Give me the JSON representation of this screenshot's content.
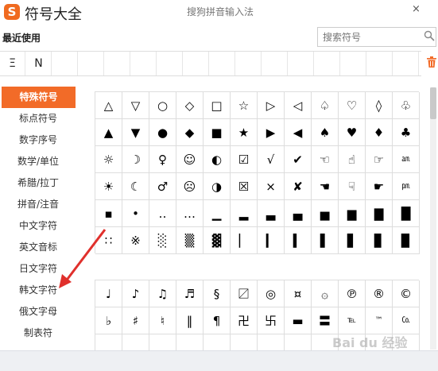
{
  "title_bar": {
    "logo_glyph": "S",
    "app_title": "符号大全",
    "sub_title": "搜狗拼音输入法",
    "close_glyph": "×"
  },
  "recent": {
    "label": "最近使用",
    "items": [
      "Ξ",
      "N"
    ],
    "empty_slots": 14
  },
  "search": {
    "placeholder": "搜索符号"
  },
  "sidebar": {
    "items": [
      "特殊符号",
      "标点符号",
      "数字序号",
      "数学/单位",
      "希腊/拉丁",
      "拼音/注音",
      "中文字符",
      "英文音标",
      "日文字符",
      "韩文字符",
      "俄文字母",
      "制表符"
    ],
    "active_index": 0
  },
  "symbols": {
    "group1": [
      [
        "△",
        "▽",
        "○",
        "◇",
        "□",
        "☆",
        "▷",
        "◁",
        "♤",
        "♡",
        "◊",
        "♧"
      ],
      [
        "▲",
        "▼",
        "●",
        "◆",
        "■",
        "★",
        "▶",
        "◀",
        "♠",
        "♥",
        "♦",
        "♣"
      ],
      [
        "☼",
        "☽",
        "♀",
        "☺",
        "◐",
        "☑",
        "√",
        "✔",
        "☜",
        "☝",
        "☞",
        "㏂"
      ],
      [
        "☀",
        "☾",
        "♂",
        "☹",
        "◑",
        "☒",
        "×",
        "✘",
        "☚",
        "☟",
        "☛",
        "㏘"
      ],
      [
        "▪",
        "•",
        "‥",
        "…",
        "▁",
        "▂",
        "▃",
        "▄",
        "▅",
        "▆",
        "▇",
        "█"
      ],
      [
        "∷",
        "※",
        "░",
        "▒",
        "▓",
        "▏",
        "▎",
        "▍",
        "▌",
        "▋",
        "▊",
        "▉"
      ]
    ],
    "group2": [
      [
        "♩",
        "♪",
        "♫",
        "♬",
        "§",
        "〼",
        "◎",
        "¤",
        "۞",
        "℗",
        "®",
        "©"
      ],
      [
        "♭",
        "♯",
        "♮",
        "‖",
        "¶",
        "卍",
        "卐",
        "▬",
        "〓",
        "℡",
        "™",
        "㏇"
      ],
      [
        "",
        "",
        "",
        "",
        "",
        "",
        "",
        "",
        "",
        "",
        "",
        ""
      ]
    ]
  },
  "watermark": "Bai du 经验",
  "colors": {
    "accent": "#f26b28",
    "arrow": "#e0302c"
  }
}
